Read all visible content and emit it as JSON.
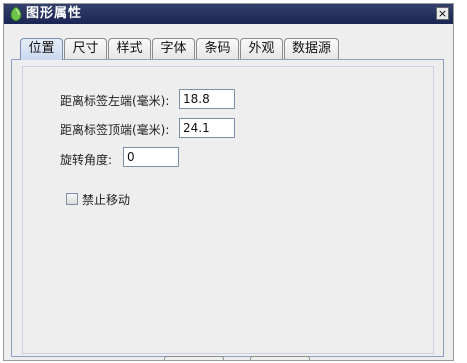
{
  "window": {
    "title": "图形属性",
    "close_symbol": "×",
    "app_icon": "green-shield-icon"
  },
  "tabs": [
    {
      "label": "位置",
      "active": true
    },
    {
      "label": "尺寸"
    },
    {
      "label": "样式"
    },
    {
      "label": "字体"
    },
    {
      "label": "条码"
    },
    {
      "label": "外观"
    },
    {
      "label": "数据源"
    }
  ],
  "position": {
    "left_label": "距离标签左端(毫米):",
    "left_value": "18.8",
    "top_label": "距离标签顶端(毫米):",
    "top_value": "24.1",
    "rotate_label": "旋转角度:",
    "rotate_value": "0",
    "lock_move_label": "禁止移动",
    "lock_move_checked": false
  }
}
